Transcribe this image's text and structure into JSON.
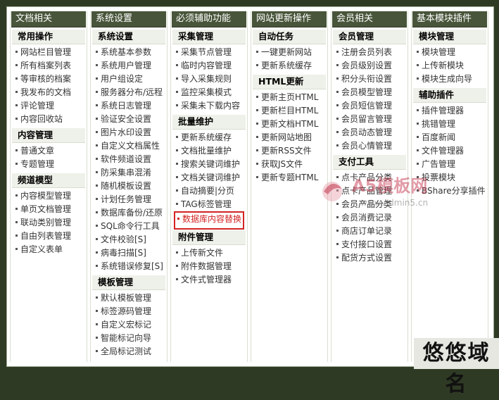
{
  "columns": [
    {
      "header": "文档相关",
      "groups": [
        {
          "title": "常用操作",
          "items": [
            "网站栏目管理",
            "所有档案列表",
            "等审核的档案",
            "我发布的文档",
            "评论管理",
            "内容回收站"
          ]
        },
        {
          "title": "内容管理",
          "items": [
            "普通文章",
            "专题管理"
          ]
        },
        {
          "title": "频道模型",
          "items": [
            "内容模型管理",
            "单页文档管理",
            "联动类别管理",
            "自由列表管理",
            "自定义表单"
          ]
        }
      ]
    },
    {
      "header": "系统设置",
      "groups": [
        {
          "title": "系统设置",
          "items": [
            "系统基本参数",
            "系统用户管理",
            "用户组设定",
            "服务器分布/远程",
            "系统日志管理",
            "验证安全设置",
            "图片水印设置",
            "自定义文档属性",
            "软件频道设置",
            "防采集串混淆",
            "随机模板设置",
            "计划任务管理",
            "数据库备份/还原",
            "SQL命令行工具",
            "文件校验[S]",
            "病毒扫描[S]",
            "系统错误修复[S]"
          ]
        },
        {
          "title": "模板管理",
          "items": [
            "默认模板管理",
            "标签源码管理",
            "自定义宏标记",
            "智能标记向导",
            "全局标记测试"
          ]
        }
      ]
    },
    {
      "header": "必须辅助功能",
      "groups": [
        {
          "title": "采集管理",
          "items": [
            "采集节点管理",
            "临时内容管理",
            "导入采集规则",
            "监控采集模式",
            "采集未下载内容"
          ]
        },
        {
          "title": "批量维护",
          "items": [
            "更新系统缓存",
            "文档批量维护",
            "搜索关键词维护",
            "文档关键词维护",
            "自动摘要|分页",
            "TAG标签管理",
            "数据库内容替换"
          ]
        },
        {
          "title": "附件管理",
          "items": [
            "上传新文件",
            "附件数据管理",
            "文件式管理器"
          ]
        }
      ]
    },
    {
      "header": "网站更新操作",
      "groups": [
        {
          "title": "自动任务",
          "items": [
            "一键更新网站",
            "更新系统缓存"
          ]
        },
        {
          "title": "HTML更新",
          "items": [
            "更新主页HTML",
            "更新栏目HTML",
            "更新文档HTML",
            "更新网站地图",
            "更新RSS文件",
            "获取JS文件",
            "更新专题HTML"
          ]
        }
      ]
    },
    {
      "header": "会员相关",
      "groups": [
        {
          "title": "会员管理",
          "items": [
            "注册会员列表",
            "会员级别设置",
            "积分头衔设置",
            "会员模型管理",
            "会员短信管理",
            "会员留言管理",
            "会员动态管理",
            "会员心情管理"
          ]
        },
        {
          "title": "支付工具",
          "items": [
            "点卡产品分类",
            "点卡产品管理",
            "会员产品分类",
            "会员消费记录",
            "商店订单记录",
            "支付接口设置",
            "配货方式设置"
          ]
        }
      ]
    },
    {
      "header": "基本模块插件",
      "groups": [
        {
          "title": "模块管理",
          "items": [
            "模块管理",
            "上传新模块",
            "模块生成向导"
          ]
        },
        {
          "title": "辅助插件",
          "items": [
            "插件管理器",
            "挑错管理",
            "百度新闻",
            "文件管理器",
            "广告管理",
            "投票模块",
            "BShare分享插件"
          ]
        }
      ]
    }
  ],
  "highlighted_item": "数据库内容替换",
  "watermark": {
    "brand": "A5模板网",
    "url": "www.Admin5.cn"
  },
  "corner_badge": "悠悠域名",
  "colors": {
    "header_bg": "#48553a",
    "group_bg": "#eef1e9",
    "highlight": "#d32424"
  }
}
